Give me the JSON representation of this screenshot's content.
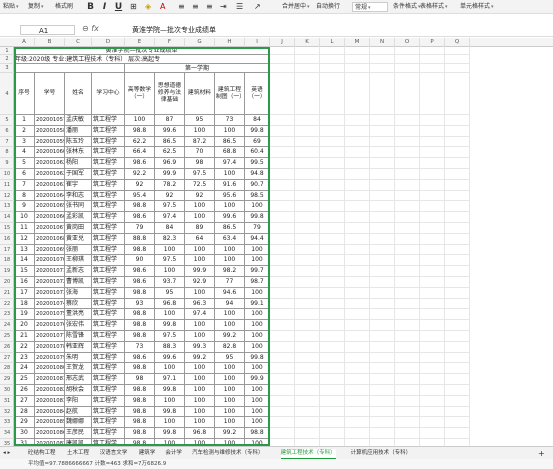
{
  "toolbar": {
    "paste": "粘贴",
    "copy": "复制",
    "format_painter": "格式刷",
    "bold": "B",
    "italic": "I",
    "underline": "U",
    "merge_center": "合并居中",
    "wrap": "自动换行",
    "number_format": "常规",
    "cond_format": "条件格式",
    "table_style": "表格样式",
    "cell_style": "单元格样式"
  },
  "formula": {
    "name_box": "A1",
    "fx": "fx",
    "value": "黄淮学院—批次专业成绩单"
  },
  "columns": [
    "A",
    "B",
    "C",
    "D",
    "E",
    "F",
    "G",
    "H",
    "I",
    "J",
    "K",
    "L",
    "M",
    "N",
    "O",
    "P",
    "Q"
  ],
  "sheet": {
    "title": "黄淮学院—批次专业成绩单",
    "subtitle": "年级:2020级  专业:建筑工程技术（专科）  层次:高起专",
    "semester": "第一学期",
    "headers": [
      "序号",
      "学号",
      "姓名",
      "学习中心",
      "高等数学（一）",
      "思想道德修养与法律基础",
      "建筑材料",
      "建筑工程制图（一）",
      "英语（一）"
    ],
    "rows": [
      [
        "1",
        "202001057",
        "孟庆敏",
        "筑工程学",
        "100",
        "87",
        "95",
        "73",
        "84"
      ],
      [
        "2",
        "202001058",
        "潘丽",
        "筑工程学",
        "98.8",
        "99.6",
        "100",
        "100",
        "99.8"
      ],
      [
        "3",
        "202001059",
        "陈玉玲",
        "筑工程学",
        "62.2",
        "86.5",
        "87.2",
        "86.5",
        "69"
      ],
      [
        "4",
        "202001060",
        "张林东",
        "筑工程学",
        "66.4",
        "62.5",
        "70",
        "68.8",
        "60.4"
      ],
      [
        "5",
        "202001062",
        "杨阳",
        "筑工程学",
        "98.6",
        "96.9",
        "98",
        "97.4",
        "99.5"
      ],
      [
        "6",
        "202001062",
        "于国军",
        "筑工程学",
        "92.2",
        "99.9",
        "97.5",
        "100",
        "94.8"
      ],
      [
        "7",
        "202001063",
        "崔宇",
        "筑工程学",
        "92",
        "78.2",
        "72.5",
        "91.6",
        "90.7"
      ],
      [
        "8",
        "202001064",
        "李和志",
        "筑工程学",
        "95.4",
        "92",
        "92",
        "95.6",
        "98.5"
      ],
      [
        "9",
        "202001065",
        "张书同",
        "筑工程学",
        "98.8",
        "97.5",
        "100",
        "100",
        "100"
      ],
      [
        "10",
        "202001066",
        "孟彩凯",
        "筑工程学",
        "98.6",
        "97.4",
        "100",
        "99.6",
        "99.8"
      ],
      [
        "11",
        "202001067",
        "黄岗田",
        "筑工程学",
        "79",
        "84",
        "89",
        "86.5",
        "79"
      ],
      [
        "12",
        "202001068",
        "黄亚兑",
        "筑工程学",
        "88.8",
        "82.3",
        "64",
        "63.4",
        "94.4"
      ],
      [
        "13",
        "202001069",
        "张丽",
        "筑工程学",
        "98.8",
        "100",
        "100",
        "100",
        "100"
      ],
      [
        "14",
        "202001070",
        "王柳琪",
        "筑工程学",
        "90",
        "97.5",
        "100",
        "100",
        "100"
      ],
      [
        "15",
        "202001071",
        "孟新志",
        "筑工程学",
        "98.6",
        "100",
        "99.9",
        "98.2",
        "99.7"
      ],
      [
        "16",
        "202001072",
        "曹博凯",
        "筑工程学",
        "98.6",
        "93.7",
        "92.9",
        "77",
        "98.7"
      ],
      [
        "17",
        "202001073",
        "张海",
        "筑工程学",
        "98.8",
        "95",
        "100",
        "94.6",
        "100"
      ],
      [
        "18",
        "202001074",
        "蔡欣",
        "筑工程学",
        "93",
        "96.8",
        "96.3",
        "94",
        "99.1"
      ],
      [
        "19",
        "202001075",
        "董洪亮",
        "筑工程学",
        "98.8",
        "100",
        "97.4",
        "100",
        "100"
      ],
      [
        "20",
        "202001076",
        "张宏伟",
        "筑工程学",
        "98.8",
        "99.8",
        "100",
        "100",
        "100"
      ],
      [
        "21",
        "202001077",
        "陈雪锋",
        "筑工程学",
        "98.8",
        "97.5",
        "100",
        "99.2",
        "100"
      ],
      [
        "22",
        "202001078",
        "韩亚辉",
        "筑工程学",
        "73",
        "88.3",
        "99.3",
        "82.8",
        "100"
      ],
      [
        "23",
        "202001079",
        "朱明",
        "筑工程学",
        "98.6",
        "99.6",
        "99.2",
        "95",
        "99.8"
      ],
      [
        "24",
        "202001080",
        "王贺龙",
        "筑工程学",
        "98.8",
        "100",
        "100",
        "100",
        "100"
      ],
      [
        "25",
        "202001081",
        "邢志武",
        "筑工程学",
        "98",
        "97.1",
        "100",
        "100",
        "99.9"
      ],
      [
        "26",
        "202001082",
        "胡秋会",
        "筑工程学",
        "98.8",
        "99.8",
        "100",
        "100",
        "100"
      ],
      [
        "27",
        "202001083",
        "李阳",
        "筑工程学",
        "98.8",
        "100",
        "100",
        "100",
        "100"
      ],
      [
        "28",
        "202001084",
        "赵航",
        "筑工程学",
        "98.8",
        "99.8",
        "100",
        "100",
        "100"
      ],
      [
        "29",
        "202001085",
        "魏娜娜",
        "筑工程学",
        "98.8",
        "100",
        "100",
        "100",
        "100"
      ],
      [
        "30",
        "202001086",
        "王彦民",
        "筑工程学",
        "98.8",
        "99.8",
        "96.8",
        "99.2",
        "98.8"
      ],
      [
        "31",
        "202001087",
        "唐凯凯",
        "筑工程学",
        "98.8",
        "100",
        "100",
        "100",
        "100"
      ],
      [
        "32",
        "202001088",
        "于天良",
        "筑工程学",
        "98.8",
        "100",
        "100",
        "100",
        "100"
      ],
      [
        "33",
        "202001089",
        "朱磊",
        "筑工程学",
        "98.8",
        "100",
        "100",
        "100",
        "100"
      ]
    ]
  },
  "tabs": [
    "砼结构工程",
    "土木工程",
    "汉语言文学",
    "建筑学",
    "会计学",
    "汽车检测与维修技术（专科）",
    "建筑工程技术（专科）",
    "计算机应用技术（专科）"
  ],
  "active_tab": 6,
  "status": "平均值=97.7886666667  计数=463  求和=7万6826.9"
}
